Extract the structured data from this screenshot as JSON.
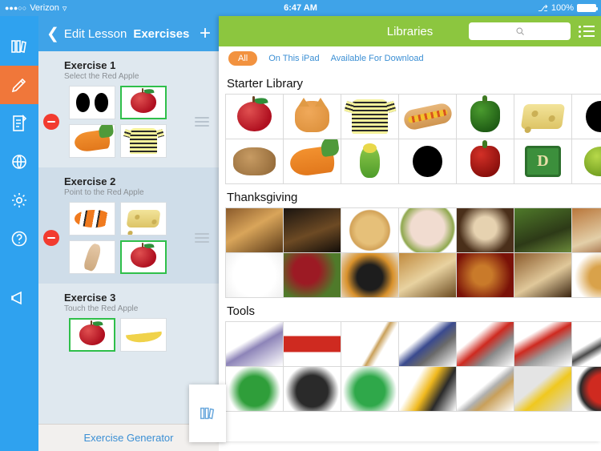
{
  "statusbar": {
    "signal_dots": "●●●○○",
    "carrier": "Verizon",
    "wifi_icon": "wifi-icon",
    "time": "6:47 AM",
    "bluetooth_icon": "bluetooth-icon",
    "battery_percent": "100%"
  },
  "rail": {
    "items": [
      {
        "name": "library-rail-icon",
        "icon": "books-icon",
        "active": false
      },
      {
        "name": "edit-rail-icon",
        "icon": "pencil-icon",
        "active": true
      },
      {
        "name": "lessons-rail-icon",
        "icon": "document-icon",
        "active": false
      },
      {
        "name": "web-rail-icon",
        "icon": "globe-icon",
        "active": false
      },
      {
        "name": "settings-rail-icon",
        "icon": "gear-icon",
        "active": false
      },
      {
        "name": "help-rail-icon",
        "icon": "question-circle-icon",
        "active": false
      },
      {
        "name": "announcements-rail-icon",
        "icon": "megaphone-icon",
        "active": false
      }
    ]
  },
  "exercise_panel": {
    "back_label": "Edit Lesson",
    "title": "Exercises",
    "add_label": "+",
    "footer_link": "Exercise Generator",
    "exercises": [
      {
        "title": "Exercise 1",
        "subtitle": "Select the Red Apple",
        "tiles": [
          {
            "label": "two black circles",
            "art": "two-circles",
            "selected": false
          },
          {
            "label": "red apple",
            "art": "apple",
            "selected": true
          },
          {
            "label": "carrots",
            "art": "carrots",
            "selected": false
          },
          {
            "label": "striped shirt",
            "art": "shirt",
            "selected": false
          }
        ]
      },
      {
        "title": "Exercise 2",
        "subtitle": "Point to the Red Apple",
        "tiles": [
          {
            "label": "clownfish",
            "art": "fish",
            "selected": false
          },
          {
            "label": "cheese",
            "art": "cheese",
            "selected": false
          },
          {
            "label": "arm",
            "art": "arm",
            "selected": false
          },
          {
            "label": "red apple",
            "art": "apple",
            "selected": true
          }
        ]
      },
      {
        "title": "Exercise 3",
        "subtitle": "Touch the Red Apple",
        "tiles": [
          {
            "label": "red apple",
            "art": "apple",
            "selected": true
          },
          {
            "label": "banana",
            "art": "banana",
            "selected": false
          }
        ]
      }
    ]
  },
  "library_panel": {
    "title": "Libraries",
    "search_placeholder": "",
    "search_icon": "search-icon",
    "list_icon": "list-view-icon",
    "filters": [
      {
        "label": "All",
        "active": true
      },
      {
        "label": "On This iPad",
        "active": false
      },
      {
        "label": "Available For Download",
        "active": false
      }
    ],
    "sections": [
      {
        "title": "Starter Library",
        "items": [
          {
            "label": "apple",
            "art": "apple"
          },
          {
            "label": "cat",
            "art": "cat"
          },
          {
            "label": "striped shirt",
            "art": "shirt"
          },
          {
            "label": "hot dog",
            "art": "hotdog"
          },
          {
            "label": "green pepper",
            "art": "pepper-green"
          },
          {
            "label": "cheese",
            "art": "cheese"
          },
          {
            "label": "black circle",
            "art": "circle"
          },
          {
            "label": "dog",
            "art": "dog"
          },
          {
            "label": "carrots",
            "art": "carrots"
          },
          {
            "label": "parakeet",
            "art": "bird"
          },
          {
            "label": "black circle",
            "art": "circle"
          },
          {
            "label": "red pepper",
            "art": "pepper-red"
          },
          {
            "label": "letter D block",
            "art": "block-d"
          },
          {
            "label": "lime",
            "art": "lime"
          }
        ]
      },
      {
        "title": "Thanksgiving",
        "items": [
          {
            "label": "harvest table",
            "art": "ph-warm1"
          },
          {
            "label": "sliced bread",
            "art": "ph-dark"
          },
          {
            "label": "pie",
            "art": "ph-pie"
          },
          {
            "label": "raw turkey",
            "art": "ph-turkeyraw"
          },
          {
            "label": "pumpkin latte",
            "art": "ph-latte"
          },
          {
            "label": "turkey in field",
            "art": "ph-turkeyfield"
          },
          {
            "label": "roast turkey plate",
            "art": "ph-turkeyplate"
          },
          {
            "label": "pilgrim woman",
            "art": "ph-pilgrim"
          },
          {
            "label": "pile of apples",
            "art": "ph-applepile"
          },
          {
            "label": "pilgrim hat",
            "art": "ph-hat"
          },
          {
            "label": "holiday feast",
            "art": "ph-feast"
          },
          {
            "label": "turkey decor",
            "art": "ph-turkeyred"
          },
          {
            "label": "carved turkey",
            "art": "ph-carve"
          },
          {
            "label": "corn bouquet",
            "art": "ph-corn"
          }
        ]
      },
      {
        "title": "Tools",
        "items": [
          {
            "label": "power drill",
            "art": "ph-drill"
          },
          {
            "label": "spirit level",
            "art": "ph-level"
          },
          {
            "label": "broom",
            "art": "ph-broom"
          },
          {
            "label": "tin snips",
            "art": "ph-snips"
          },
          {
            "label": "pliers",
            "art": "ph-pliers"
          },
          {
            "label": "chainsaw",
            "art": "ph-chainsaw"
          },
          {
            "label": "wrench",
            "art": "ph-wrench"
          },
          {
            "label": "dustpan",
            "art": "ph-dustpan"
          },
          {
            "label": "dustpan and brush",
            "art": "ph-dustset"
          },
          {
            "label": "watering can",
            "art": "ph-can"
          },
          {
            "label": "flashlight",
            "art": "ph-flash"
          },
          {
            "label": "garden shears",
            "art": "ph-shears"
          },
          {
            "label": "hoe",
            "art": "ph-hoe"
          },
          {
            "label": "ear protection",
            "art": "ph-ear"
          }
        ]
      }
    ]
  },
  "popover": {
    "icon": "books-icon"
  },
  "colors": {
    "status_blue": "#3fa3e8",
    "rail_blue": "#2fa2ef",
    "rail_active_orange": "#f0773a",
    "library_green": "#8cc63f",
    "chip_orange": "#f2923f",
    "link_blue": "#3b8fd4",
    "selected_green": "#2fbf4a",
    "delete_red": "#f23b2f",
    "panel_blue_grey": "#dfe8ef"
  }
}
